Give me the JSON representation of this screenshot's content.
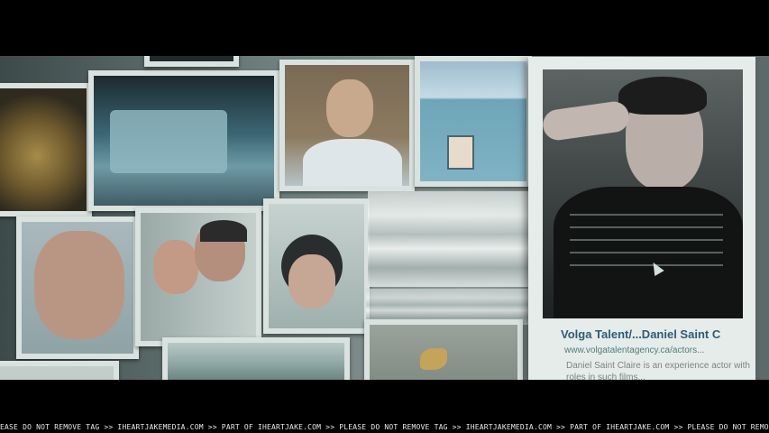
{
  "search_results": {
    "featured": {
      "title": "Volga Talent/...Daniel Saint C",
      "url": "www.volgatalentagency.ca/actors...",
      "snippet": "Daniel Saint Claire is an experience actor with roles in such films..."
    }
  },
  "watermark": {
    "text": "EASE DO NOT REMOVE TAG >> IHEARTJAKEMEDIA.COM >> PART OF IHEARTJAKE.COM >> PLEASE DO NOT REMOVE TAG >> IHEARTJAKEMEDIA.COM >> PART OF IHEARTJAKE.COM >> PLEASE DO NOT REMOVE TAG >> IHEARTJAKE"
  },
  "icons": {
    "pointer": "mouse-pointer-icon"
  },
  "colors": {
    "link": "#2c5d78",
    "url": "#4f7e7a",
    "snippet": "#7b8483",
    "tile_border": "#d9e2df"
  }
}
